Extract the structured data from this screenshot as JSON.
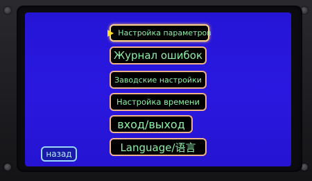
{
  "menu": {
    "items": [
      {
        "label": "Настройка параметров",
        "selected": true
      },
      {
        "label": "Журнал ошибок",
        "selected": false
      },
      {
        "label": "Заводские настройки",
        "selected": false
      },
      {
        "label": "Настройка времени",
        "selected": false
      },
      {
        "label": "вход/выход",
        "selected": false
      },
      {
        "label": "Language/语言",
        "selected": false
      }
    ]
  },
  "back_button": {
    "label": "назад"
  },
  "colors": {
    "screen_background": "#2a18e0",
    "button_background": "#000000",
    "button_border": "#f0b28a",
    "button_text": "#8ff0a8",
    "selection_arrow": "#ffe020",
    "back_button_border": "#9ad8ff"
  },
  "icons": {
    "selection_indicator": "play-arrow-icon"
  }
}
